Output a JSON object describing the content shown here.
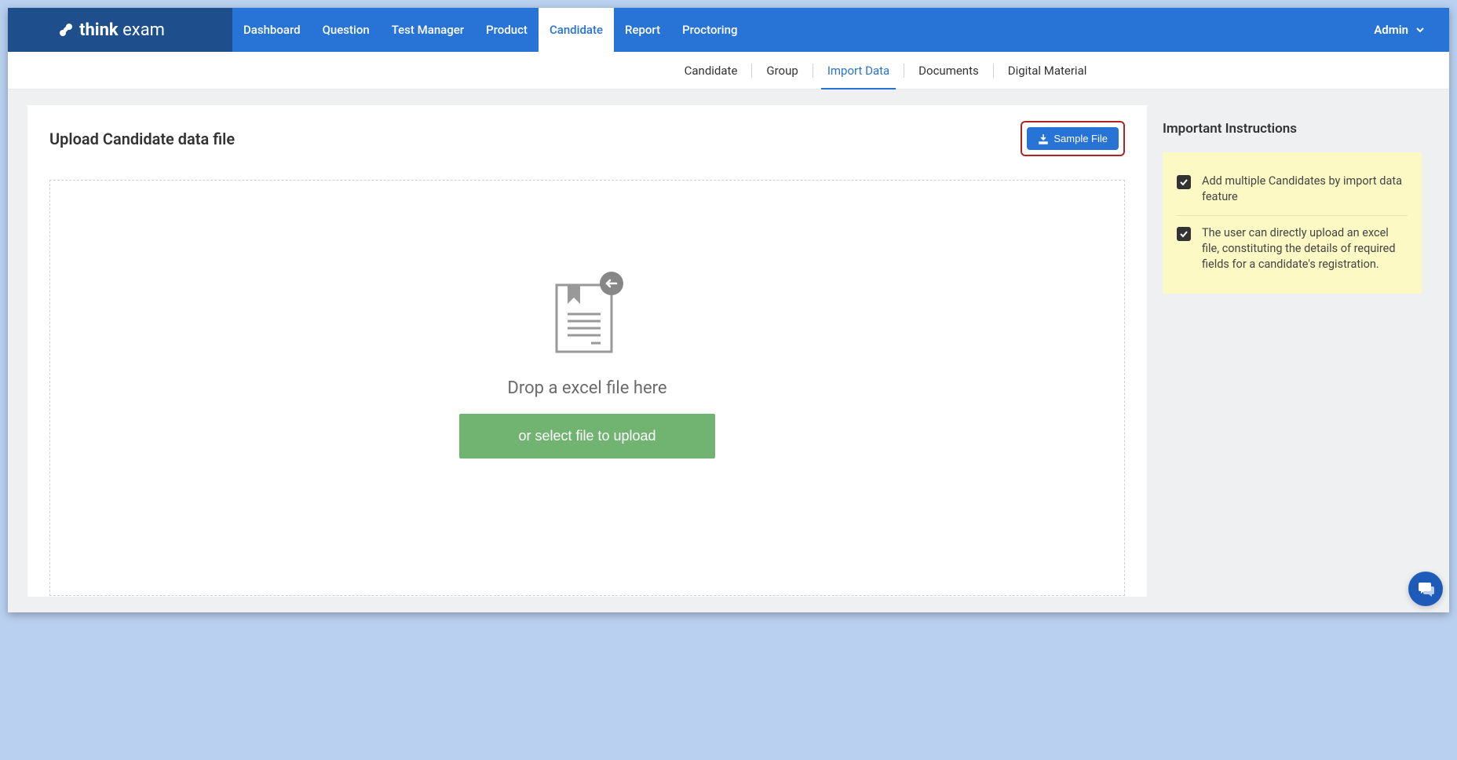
{
  "logo": {
    "bold": "think",
    "light": " exam"
  },
  "nav": {
    "items": [
      {
        "label": "Dashboard"
      },
      {
        "label": "Question"
      },
      {
        "label": "Test Manager"
      },
      {
        "label": "Product"
      },
      {
        "label": "Candidate"
      },
      {
        "label": "Report"
      },
      {
        "label": "Proctoring"
      }
    ],
    "user": "Admin"
  },
  "subnav": {
    "items": [
      {
        "label": "Candidate"
      },
      {
        "label": "Group"
      },
      {
        "label": "Import Data"
      },
      {
        "label": "Documents"
      },
      {
        "label": "Digital Material"
      }
    ]
  },
  "main": {
    "title": "Upload Candidate data file",
    "sample_btn": "Sample File",
    "drop_text": "Drop a excel file here",
    "select_btn": "or select file to upload"
  },
  "sidebar": {
    "title": "Important Instructions",
    "instructions": [
      {
        "text": "Add multiple Candidates by import data feature"
      },
      {
        "text": "The user can directly upload an excel file, constituting the details of required fields for a candidate's registration."
      }
    ]
  }
}
